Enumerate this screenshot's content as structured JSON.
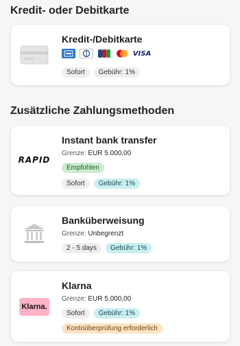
{
  "sections": {
    "cards_title": "Kredit- oder Debitkarte",
    "additional_title": "Zusätzliche Zahlungsmethoden"
  },
  "credit_card": {
    "title": "Kredit-/Debitkarte",
    "brands": [
      "amex-icon",
      "diners-club-icon",
      "jcb-icon",
      "mastercard-icon",
      "visa-icon"
    ],
    "visa_label": "VISA",
    "chips": [
      "Sofort",
      "Gebühr: 1%"
    ]
  },
  "rapid": {
    "title": "Instant bank transfer",
    "limit_label": "Grenze:",
    "limit_value": "EUR 5.000,00",
    "badge": "Empfohlen",
    "chips": [
      "Sofort",
      "Gebühr: 1%"
    ],
    "logo_text": "RAPID"
  },
  "bank": {
    "title": "Banküberweisung",
    "limit_label": "Grenze:",
    "limit_value": "Unbegrenzt",
    "chips": [
      "2 - 5 days",
      "Gebühr: 1%"
    ]
  },
  "klarna": {
    "title": "Klarna",
    "limit_label": "Grenze:",
    "limit_value": "EUR 5.000,00",
    "chips": [
      "Sofort",
      "Gebühr: 1%"
    ],
    "note": "Kontoüberprüfung erforderlich",
    "logo_text": "Klarna."
  },
  "colors": {
    "background": "#f6f6f6",
    "card": "#ffffff",
    "chip_gray": "#eeeeee",
    "chip_cyan": "#c9eff2",
    "chip_green": "#cdeccf",
    "chip_orange": "#fde4c4",
    "klarna_pink": "#ffb3c7"
  }
}
